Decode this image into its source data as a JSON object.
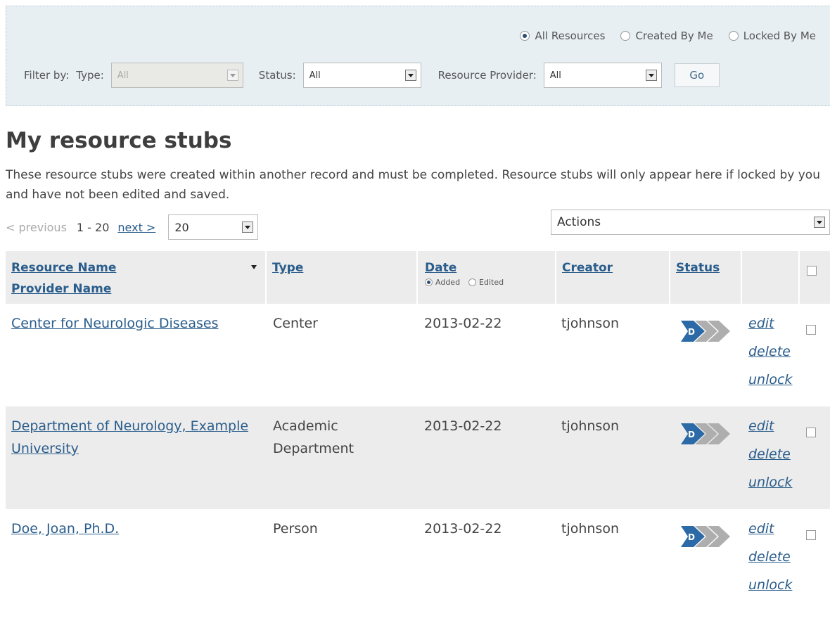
{
  "filters": {
    "scope_options": [
      {
        "label": "All Resources",
        "selected": true
      },
      {
        "label": "Created By Me",
        "selected": false
      },
      {
        "label": "Locked By Me",
        "selected": false
      }
    ],
    "filter_by_label": "Filter by:",
    "type_label": "Type:",
    "type_value": "All",
    "status_label": "Status:",
    "status_value": "All",
    "provider_label": "Resource Provider:",
    "provider_value": "All",
    "go_label": "Go"
  },
  "page": {
    "title": "My resource stubs",
    "intro": "These resource stubs were created within another record and must be completed. Resource stubs will only appear here if locked by you and have not been edited and saved."
  },
  "paging": {
    "previous": "< previous",
    "range": "1 - 20",
    "next": "next >",
    "per_page": "20",
    "actions": "Actions"
  },
  "table": {
    "headers": {
      "resource_name": "Resource Name",
      "provider_name": "Provider Name",
      "type": "Type",
      "date": "Date",
      "date_added": "Added",
      "date_edited": "Edited",
      "creator": "Creator",
      "status": "Status"
    },
    "rows": [
      {
        "name": "Center for Neurologic Diseases",
        "type": "Center",
        "date": "2013-02-22",
        "creator": "tjohnson",
        "status_letter": "D",
        "edit": "edit",
        "delete": "delete",
        "unlock": "unlock"
      },
      {
        "name": "Department of Neurology, Example University",
        "type": "Academic Department",
        "date": "2013-02-22",
        "creator": "tjohnson",
        "status_letter": "D",
        "edit": "edit",
        "delete": "delete",
        "unlock": "unlock"
      },
      {
        "name": "Doe, Joan, Ph.D.",
        "type": "Person",
        "date": "2013-02-22",
        "creator": "tjohnson",
        "status_letter": "D",
        "edit": "edit",
        "delete": "delete",
        "unlock": "unlock"
      }
    ]
  },
  "colors": {
    "link": "#2a5d8c",
    "status_active": "#2b6aa6",
    "status_inactive": "#aeaeae",
    "panel": "#e8eff3"
  }
}
